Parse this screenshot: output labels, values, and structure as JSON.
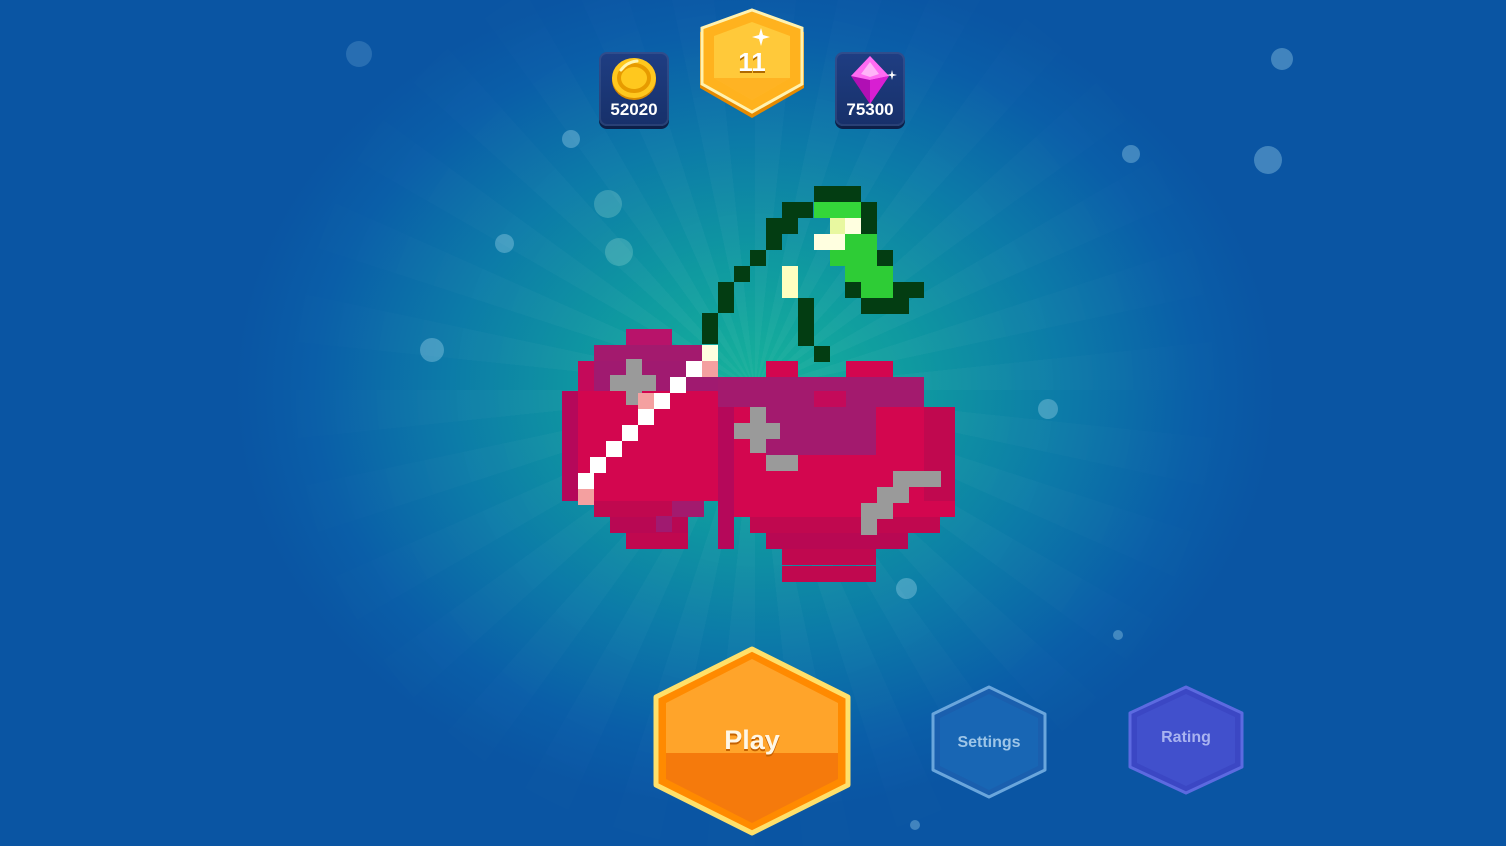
{
  "hud": {
    "coins": "52020",
    "level": "11",
    "gems": "75300"
  },
  "icons": {
    "coin": "gold-coin-icon",
    "gem": "pink-gem-icon",
    "level": "level-badge-icon"
  },
  "artwork": {
    "subject": "pixel-art-cherries"
  },
  "menu": {
    "play_label": "Play",
    "settings_label": "Settings",
    "rating_label": "Rating"
  },
  "colors": {
    "play": "#f7a21b",
    "settings": "#1b6fb6",
    "rating": "#3f4fc8",
    "coin": "#f5c518",
    "gem": "#e02bd8"
  }
}
